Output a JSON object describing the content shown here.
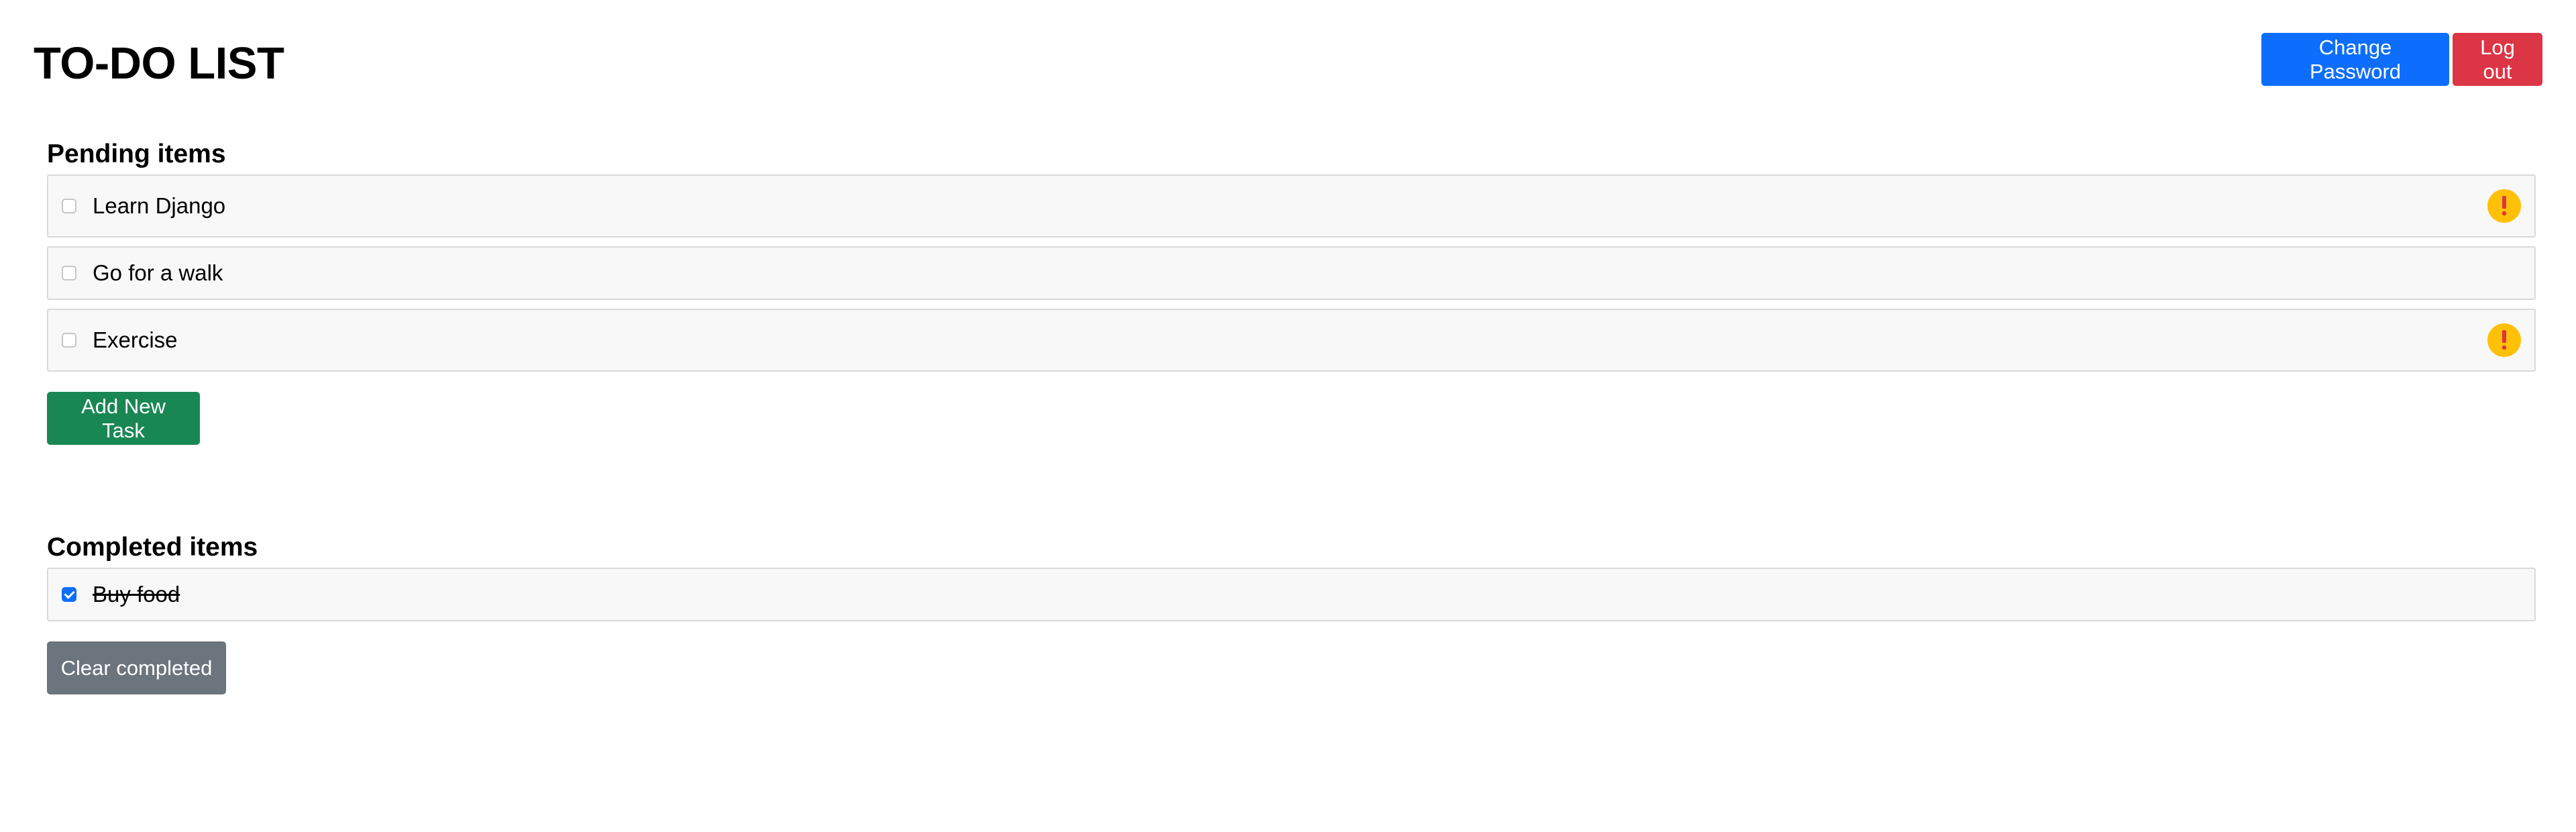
{
  "header": {
    "title": "TO-DO LIST",
    "change_password_label": "Change Password",
    "logout_label": "Log out"
  },
  "pending": {
    "heading": "Pending items",
    "items": [
      {
        "label": "Learn Django",
        "checked": false,
        "priority": true,
        "priority_icon": "exclamation-icon"
      },
      {
        "label": "Go for a walk",
        "checked": false,
        "priority": false
      },
      {
        "label": "Exercise",
        "checked": false,
        "priority": true,
        "priority_icon": "exclamation-icon"
      }
    ],
    "add_button_label": "Add New Task"
  },
  "completed": {
    "heading": "Completed items",
    "items": [
      {
        "label": "Buy food",
        "checked": true
      }
    ],
    "clear_button_label": "Clear completed"
  },
  "colors": {
    "primary": "#0d6efd",
    "danger": "#dc3545",
    "success": "#198754",
    "secondary": "#6c757d",
    "warning": "#ffc107",
    "warning_mark": "#dc3545"
  }
}
